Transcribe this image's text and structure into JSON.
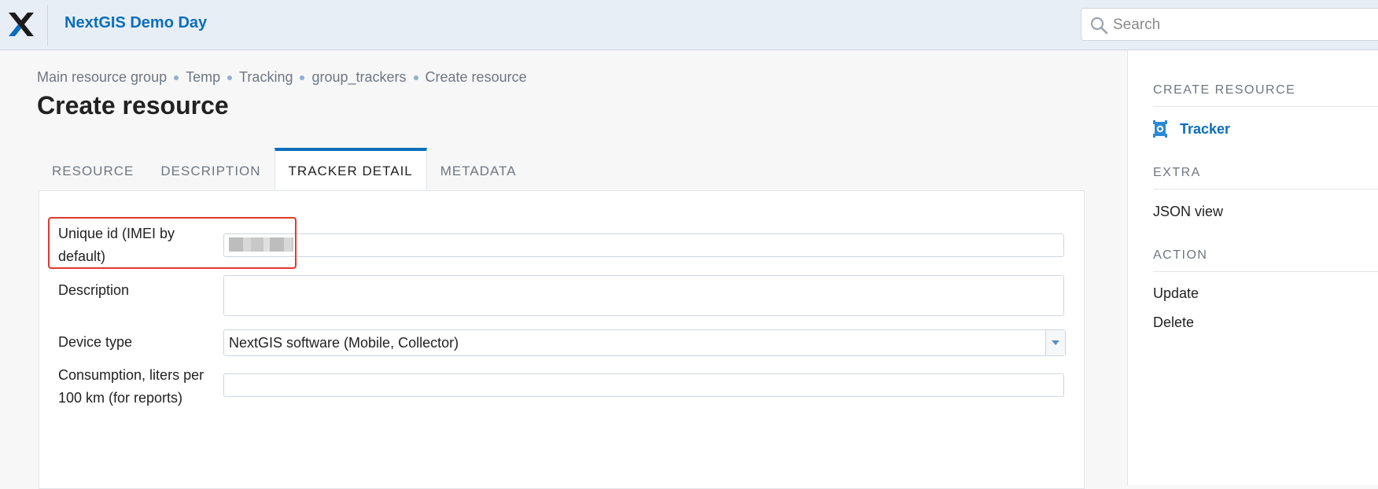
{
  "header": {
    "app_title": "NextGIS Demo Day",
    "search_placeholder": "Search"
  },
  "breadcrumbs": [
    "Main resource group",
    "Temp",
    "Tracking",
    "group_trackers",
    "Create resource"
  ],
  "page_title": "Create resource",
  "tabs": [
    {
      "label": "RESOURCE"
    },
    {
      "label": "DESCRIPTION"
    },
    {
      "label": "TRACKER DETAIL",
      "active": true
    },
    {
      "label": "METADATA"
    }
  ],
  "form": {
    "unique_id": {
      "label": "Unique id (IMEI by default)",
      "value": ""
    },
    "description": {
      "label": "Description",
      "value": ""
    },
    "device_type": {
      "label": "Device type",
      "value": "NextGIS software (Mobile, Collector)"
    },
    "consumption": {
      "label": "Consumption, liters per 100 km (for reports)",
      "value": ""
    }
  },
  "sidebar": {
    "create_resource": {
      "heading": "CREATE RESOURCE",
      "items": [
        {
          "label": "Tracker",
          "icon": "tracker-icon"
        }
      ]
    },
    "extra": {
      "heading": "EXTRA",
      "items": [
        {
          "label": "JSON view"
        }
      ]
    },
    "action": {
      "heading": "ACTION",
      "items": [
        {
          "label": "Update"
        },
        {
          "label": "Delete"
        }
      ]
    }
  },
  "colors": {
    "accent": "#0a6ebd",
    "header_bg": "#e8eef6",
    "highlight": "#e0392b"
  }
}
